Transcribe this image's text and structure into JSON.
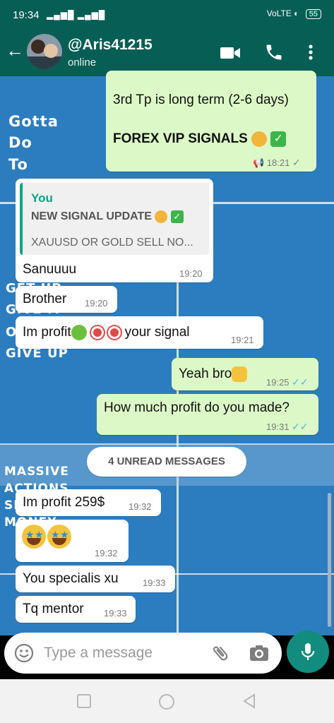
{
  "status_bar": {
    "time": "19:34",
    "signal": "▂▄▆█ ▂▄▆█",
    "right_text": "VoLTE ◐",
    "battery": "55"
  },
  "header": {
    "contact_name": "@Aris41215",
    "status": "online"
  },
  "wallpaper": {
    "texts": [
      "Gotta",
      "Do",
      "To",
      "GET UP",
      "GIVE IT",
      "OR",
      "GIVE UP",
      "MASSIVE",
      "ACTIONS",
      "SM",
      "MONEY"
    ]
  },
  "messages": [
    {
      "direction": "out",
      "text": "3rd Tp is long term (2-6 days)",
      "text2": "FOREX VIP SIGNALS",
      "time": "18:21"
    },
    {
      "direction": "in",
      "quote_author": "You",
      "quote_title": "NEW SIGNAL UPDATE",
      "quote_text": "XAUUSD OR GOLD SELL NO...",
      "text": "Sanuuuu",
      "time": "19:20"
    },
    {
      "direction": "in",
      "text": "Brother",
      "time": "19:20"
    },
    {
      "direction": "in",
      "text": "Im profit",
      "text_after": "your signal",
      "time": "19:21"
    },
    {
      "direction": "out",
      "text": "Yeah bro",
      "time": "19:25"
    },
    {
      "direction": "out",
      "text": "How much profit do you made?",
      "time": "19:31"
    },
    {
      "direction": "in",
      "text": "Im profit 259$",
      "time": "19:32"
    },
    {
      "direction": "in",
      "text": "",
      "time": "19:32"
    },
    {
      "direction": "in",
      "text": "You specialis xu",
      "time": "19:33"
    },
    {
      "direction": "in",
      "text": "Tq mentor",
      "time": "19:33"
    }
  ],
  "unread_banner": "4 UNREAD MESSAGES",
  "input": {
    "placeholder": "Type a message"
  },
  "colors": {
    "header": "#075e54",
    "outgoing_bubble": "#dcf8c6",
    "incoming_bubble": "#ffffff",
    "wallpaper": "#2c7dc0",
    "mic_button": "#128c7e"
  }
}
